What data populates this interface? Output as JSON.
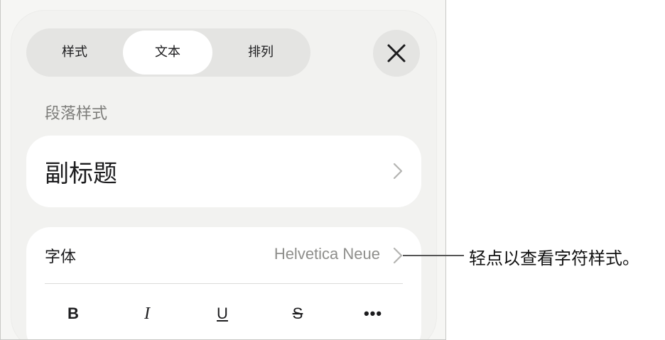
{
  "tabs": [
    {
      "label": "样式",
      "selected": false
    },
    {
      "label": "文本",
      "selected": true
    },
    {
      "label": "排列",
      "selected": false
    }
  ],
  "close_icon": "close-icon",
  "paragraph_style": {
    "section_label": "段落样式",
    "current": "副标题"
  },
  "font": {
    "label": "字体",
    "value": "Helvetica Neue"
  },
  "format_buttons": [
    {
      "label": "B",
      "name": "bold"
    },
    {
      "label": "I",
      "name": "italic"
    },
    {
      "label": "U",
      "name": "underline"
    },
    {
      "label": "S",
      "name": "strikethrough"
    },
    {
      "label": "•••",
      "name": "more"
    }
  ],
  "callout": "轻点以查看字符样式。",
  "colors": {
    "panel_bg": "#f2f2f0",
    "card_bg": "#ffffff",
    "secondary_text": "#8e8e8b"
  }
}
